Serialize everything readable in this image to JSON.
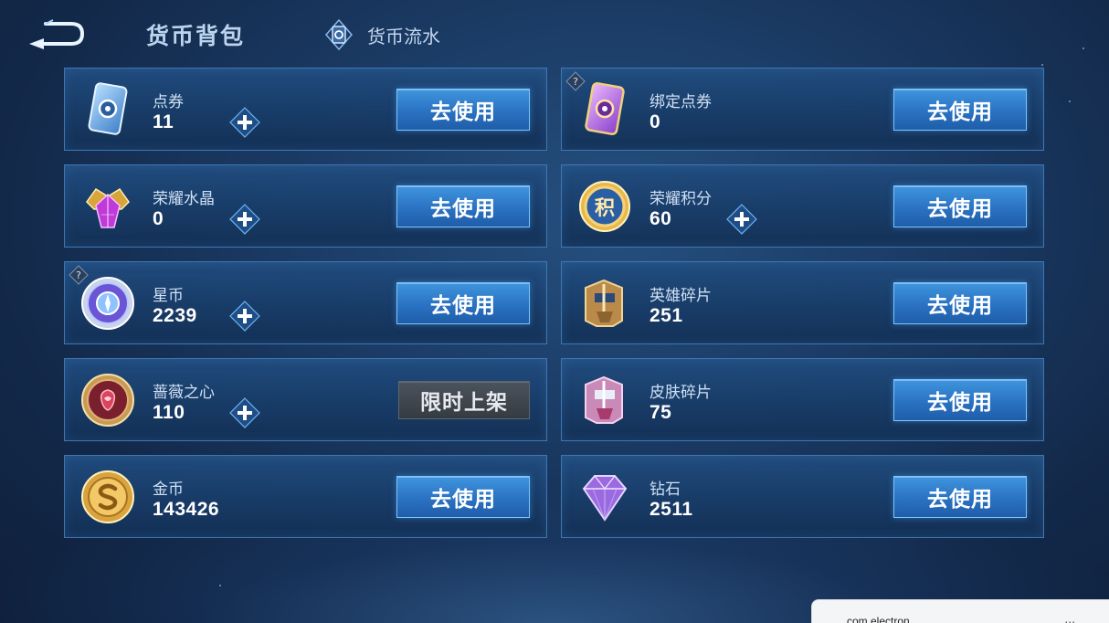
{
  "header": {
    "title": "货币背包",
    "flow_tab_label": "货币流水"
  },
  "currencies": [
    {
      "name": "点券",
      "amount": "11",
      "button": "去使用",
      "icon": "ticket-icon"
    },
    {
      "name": "绑定点券",
      "amount": "0",
      "button": "去使用",
      "icon": "bound-ticket-icon"
    },
    {
      "name": "荣耀水晶",
      "amount": "0",
      "button": "去使用",
      "icon": "glory-crystal-icon"
    },
    {
      "name": "荣耀积分",
      "amount": "60",
      "button": "去使用",
      "icon": "glory-points-icon"
    },
    {
      "name": "星币",
      "amount": "2239",
      "button": "去使用",
      "icon": "star-coin-icon"
    },
    {
      "name": "英雄碎片",
      "amount": "251",
      "button": "去使用",
      "icon": "hero-fragment-icon"
    },
    {
      "name": "蔷薇之心",
      "amount": "110",
      "button": "限时上架",
      "icon": "rose-heart-icon"
    },
    {
      "name": "皮肤碎片",
      "amount": "75",
      "button": "去使用",
      "icon": "skin-fragment-icon"
    },
    {
      "name": "金币",
      "amount": "143426",
      "button": "去使用",
      "icon": "gold-coin-icon"
    },
    {
      "name": "钻石",
      "amount": "2511",
      "button": "去使用",
      "icon": "diamond-icon"
    }
  ],
  "glyphs": {
    "glory_points": "积"
  },
  "notification": {
    "app_name": "com.electron",
    "more": "..."
  },
  "colors": {
    "button_blue": "#2a72c2",
    "button_limited": "#353b43",
    "card_border": "#3f77b2"
  }
}
